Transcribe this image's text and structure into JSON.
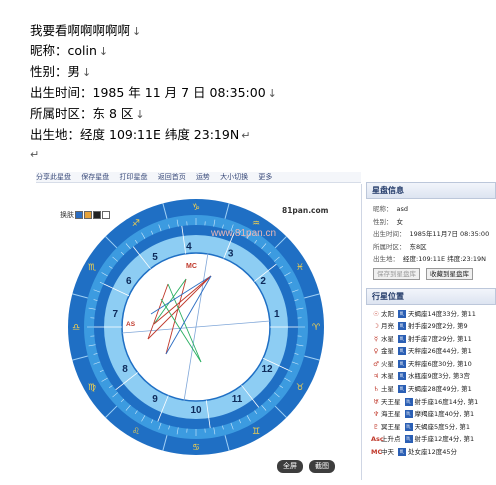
{
  "doc": {
    "lines": [
      {
        "label": "我要看啊啊啊啊啊",
        "value": ""
      },
      {
        "label": "昵称：",
        "value": "colin"
      },
      {
        "label": "性别：",
        "value": "男"
      },
      {
        "label": "出生时间：",
        "value": "1985 年 11 月 7 日 08:35:00"
      },
      {
        "label": "所属时区：",
        "value": "东 8 区"
      },
      {
        "label": "出生地：",
        "value": "经度 109:11E 纬度 23:19N"
      }
    ],
    "return_mark": "↵",
    "line_break_mark": "↓"
  },
  "screenshot": {
    "topbar_items": [
      "分享此星盘",
      "保存星盘",
      "打印星盘",
      "返回首页",
      "运势",
      "大小切换",
      "更多"
    ],
    "switch_label": "换肤",
    "site": "81pan.com",
    "fullscreen_button": "全屏",
    "screenshot_button": "截图",
    "watermark": "www.81pan.cn",
    "house_numbers": [
      "1",
      "2",
      "3",
      "4",
      "5",
      "6",
      "7",
      "8",
      "9",
      "10",
      "11",
      "12"
    ],
    "chart_labels": {
      "mc": "MC",
      "asc": "AS"
    },
    "colors": {
      "ring_outer": "#1f6fc4",
      "ring_mid": "#3c9be0",
      "ring_inner": "#8dcdf3",
      "center": "#ffffff",
      "aspect_red": "#c0392b",
      "aspect_green": "#27ae60",
      "aspect_blue": "#2b6dc2"
    }
  },
  "info_panel": {
    "title": "星盘信息",
    "rows": [
      {
        "label": "昵称：",
        "value": "asd"
      },
      {
        "label": "性别：",
        "value": "女"
      },
      {
        "label": "出生时间：",
        "value": "1985年11月7日 08:35:00"
      },
      {
        "label": "所属时区：",
        "value": "东8区"
      },
      {
        "label": "出生地：",
        "value": "经度:109:11E 纬度:23:19N"
      }
    ],
    "save_label": "保存到星盘库",
    "favorite_label": "收藏到星盘库"
  },
  "planet_panel": {
    "title": "行星位置",
    "rows": [
      {
        "glyph": "☉",
        "name": "太阳",
        "pos": "天蝎座14度33分",
        "house": "第11"
      },
      {
        "glyph": "☽",
        "name": "月亮",
        "pos": "射手座29度2分",
        "house": "第9"
      },
      {
        "glyph": "☿",
        "name": "水星",
        "pos": "射手座7度29分",
        "house": "第11"
      },
      {
        "glyph": "♀",
        "name": "金星",
        "pos": "天秤座26度44分",
        "house": "第1"
      },
      {
        "glyph": "♂",
        "name": "火星",
        "pos": "天秤座6度30分",
        "house": "第10"
      },
      {
        "glyph": "♃",
        "name": "木星",
        "pos": "水瓶座9度3分",
        "house": "第3宫"
      },
      {
        "glyph": "♄",
        "name": "土星",
        "pos": "天蝎座28度49分",
        "house": "第1"
      },
      {
        "glyph": "♅",
        "name": "天王星",
        "pos": "射手座16度14分",
        "house": "第1"
      },
      {
        "glyph": "♆",
        "name": "海王星",
        "pos": "摩羯座1度40分",
        "house": "第1"
      },
      {
        "glyph": "♇",
        "name": "冥王星",
        "pos": "天蝎座5度5分",
        "house": "第1"
      },
      {
        "glyph": "Asc",
        "name": "上升点",
        "pos": "射手座12度4分",
        "house": "第1"
      },
      {
        "glyph": "MC",
        "name": "中天",
        "pos": "处女座12度45分",
        "house": ""
      }
    ]
  }
}
